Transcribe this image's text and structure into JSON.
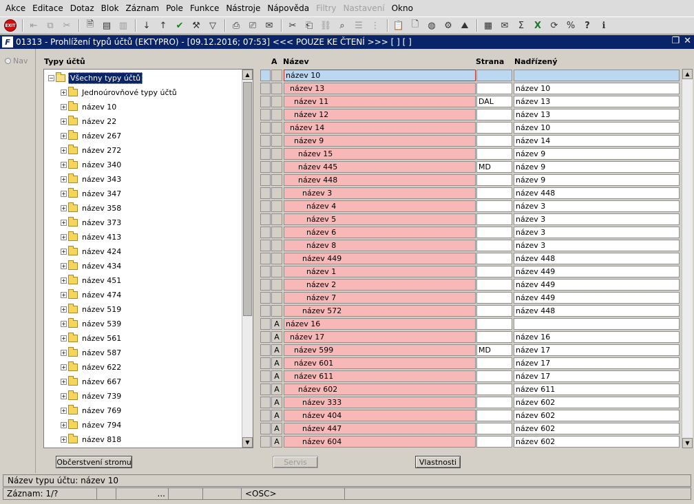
{
  "menu": [
    "Akce",
    "Editace",
    "Dotaz",
    "Blok",
    "Záznam",
    "Pole",
    "Funkce",
    "Nástroje",
    "Nápověda",
    "Filtry",
    "Nastavení",
    "Okno"
  ],
  "menu_disabled": [
    "Filtry",
    "Nastavení"
  ],
  "toolbar_exit": "EXIT",
  "window": {
    "icon_text": "F",
    "title": "01313 - Prohlížení typů účtů (EKTYPRO) - [09.12.2016; 07:53] <<< POUZE KE ČTENÍ >>>  [ ]  [ ]"
  },
  "nav_label": "Nav",
  "tree": {
    "header": "Typy účtů",
    "root": "Všechny typy účtů",
    "items": [
      "Jednoúrovňové typy účtů",
      "název 10",
      "název 22",
      "název 267",
      "název 272",
      "název 340",
      "název 343",
      "název 347",
      "název 358",
      "název 373",
      "název 413",
      "název 424",
      "název 434",
      "název 451",
      "název 474",
      "název 519",
      "název 539",
      "název 561",
      "název 587",
      "název 622",
      "název 667",
      "název 739",
      "název 769",
      "název 794",
      "název 818"
    ]
  },
  "grid": {
    "headers": {
      "a": "A",
      "name": "Název",
      "strana": "Strana",
      "nadrizeny": "Nadřízený"
    },
    "rows": [
      {
        "a": "",
        "name": "název 10",
        "strana": "",
        "nadr": "",
        "level": 0
      },
      {
        "a": "",
        "name": "název 13",
        "strana": "",
        "nadr": "název 10",
        "level": 1
      },
      {
        "a": "",
        "name": "název 11",
        "strana": "DAL",
        "nadr": "název 13",
        "level": 2
      },
      {
        "a": "",
        "name": "název 12",
        "strana": "",
        "nadr": "název 13",
        "level": 2
      },
      {
        "a": "",
        "name": "název 14",
        "strana": "",
        "nadr": "název 10",
        "level": 1
      },
      {
        "a": "",
        "name": "název 9",
        "strana": "",
        "nadr": "název 14",
        "level": 2
      },
      {
        "a": "",
        "name": "název 15",
        "strana": "",
        "nadr": "název 9",
        "level": 3
      },
      {
        "a": "",
        "name": "název 445",
        "strana": "MD",
        "nadr": "název 9",
        "level": 3
      },
      {
        "a": "",
        "name": "název 448",
        "strana": "",
        "nadr": "název 9",
        "level": 3
      },
      {
        "a": "",
        "name": "název 3",
        "strana": "",
        "nadr": "název 448",
        "level": 4
      },
      {
        "a": "",
        "name": "název 4",
        "strana": "",
        "nadr": "název 3",
        "level": 5
      },
      {
        "a": "",
        "name": "název 5",
        "strana": "",
        "nadr": "název 3",
        "level": 5
      },
      {
        "a": "",
        "name": "název 6",
        "strana": "",
        "nadr": "název 3",
        "level": 5
      },
      {
        "a": "",
        "name": "název 8",
        "strana": "",
        "nadr": "název 3",
        "level": 5
      },
      {
        "a": "",
        "name": "název 449",
        "strana": "",
        "nadr": "název 448",
        "level": 4
      },
      {
        "a": "",
        "name": "název 1",
        "strana": "",
        "nadr": "název 449",
        "level": 5
      },
      {
        "a": "",
        "name": "název 2",
        "strana": "",
        "nadr": "název 449",
        "level": 5
      },
      {
        "a": "",
        "name": "název 7",
        "strana": "",
        "nadr": "název 449",
        "level": 5
      },
      {
        "a": "",
        "name": "název 572",
        "strana": "",
        "nadr": "název 448",
        "level": 4
      },
      {
        "a": "A",
        "name": "název 16",
        "strana": "",
        "nadr": "",
        "level": 0
      },
      {
        "a": "A",
        "name": "název 17",
        "strana": "",
        "nadr": "název 16",
        "level": 1
      },
      {
        "a": "A",
        "name": "název 599",
        "strana": "MD",
        "nadr": "název 17",
        "level": 2
      },
      {
        "a": "A",
        "name": "název 601",
        "strana": "",
        "nadr": "název 17",
        "level": 2
      },
      {
        "a": "A",
        "name": "název 611",
        "strana": "",
        "nadr": "název 17",
        "level": 2
      },
      {
        "a": "A",
        "name": "název 602",
        "strana": "",
        "nadr": "název 611",
        "level": 3
      },
      {
        "a": "A",
        "name": "název 333",
        "strana": "",
        "nadr": "název 602",
        "level": 4
      },
      {
        "a": "A",
        "name": "název 404",
        "strana": "",
        "nadr": "název 602",
        "level": 4
      },
      {
        "a": "A",
        "name": "název 447",
        "strana": "",
        "nadr": "název 602",
        "level": 4
      },
      {
        "a": "A",
        "name": "název 604",
        "strana": "",
        "nadr": "název 602",
        "level": 4
      }
    ]
  },
  "buttons": {
    "refresh": "Občerstvení stromu",
    "servis": "Servis",
    "props": "Vlastnosti"
  },
  "status": {
    "line1": "Název typu účtu: název 10",
    "record": "Záznam: 1/?",
    "dots": "...",
    "osc": "<OSC>"
  },
  "colors": {
    "titlebar": "#0a246a",
    "row_pink": "#f8b8b8",
    "row_current": "#bcd8f0"
  }
}
